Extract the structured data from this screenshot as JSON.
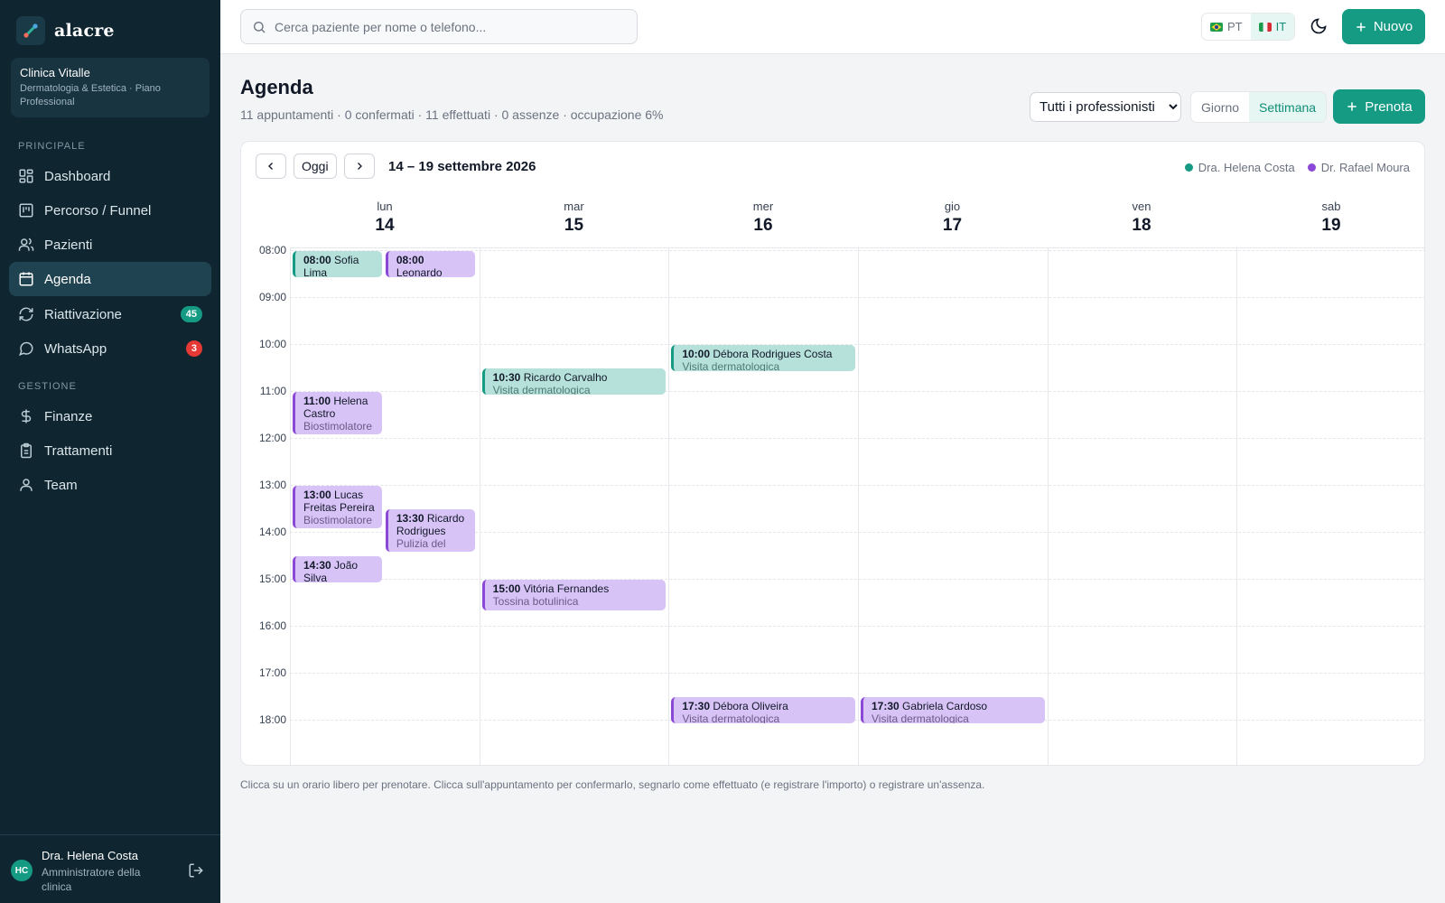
{
  "brand": {
    "name": "alacre"
  },
  "clinic": {
    "name": "Clinica Vitalle",
    "plan": "Dermatologia & Estetica · Piano Professional"
  },
  "sidebar": {
    "section_principale": "PRINCIPALE",
    "section_gestione": "GESTIONE",
    "items": [
      {
        "label": "Dashboard",
        "icon": "dashboard-icon"
      },
      {
        "label": "Percorso / Funnel",
        "icon": "funnel-icon"
      },
      {
        "label": "Pazienti",
        "icon": "users-icon"
      },
      {
        "label": "Agenda",
        "icon": "calendar-icon",
        "active": true
      },
      {
        "label": "Riattivazione",
        "icon": "refresh-icon",
        "badge": "45",
        "badge_color": "#159a83"
      },
      {
        "label": "WhatsApp",
        "icon": "chat-icon",
        "badge": "3",
        "badge_color": "#e53935"
      },
      {
        "label": "Finanze",
        "icon": "dollar-icon"
      },
      {
        "label": "Trattamenti",
        "icon": "clipboard-icon"
      },
      {
        "label": "Team",
        "icon": "user-icon"
      }
    ]
  },
  "user": {
    "initials": "HC",
    "name": "Dra. Helena Costa",
    "role": "Amministratore della clinica"
  },
  "topbar": {
    "search_placeholder": "Cerca paziente per nome o telefono...",
    "lang_pt": "PT",
    "lang_it": "IT",
    "new_label": "Nuovo"
  },
  "page": {
    "title": "Agenda",
    "subtitle": "11 appuntamenti · 0 confermati · 11 effettuati · 0 assenze · occupazione 6%",
    "professional_filter": "Tutti i professionisti",
    "view_day": "Giorno",
    "view_week": "Settimana",
    "book_label": "Prenota"
  },
  "calendar": {
    "today_label": "Oggi",
    "range": "14 – 19 settembre 2026",
    "legend": [
      {
        "name": "Dra. Helena Costa",
        "color": "#159a83"
      },
      {
        "name": "Dr. Rafael Moura",
        "color": "#8b47d6"
      }
    ],
    "days": [
      {
        "name": "lun",
        "num": "14"
      },
      {
        "name": "mar",
        "num": "15"
      },
      {
        "name": "mer",
        "num": "16"
      },
      {
        "name": "gio",
        "num": "17"
      },
      {
        "name": "ven",
        "num": "18"
      },
      {
        "name": "sab",
        "num": "19"
      }
    ],
    "hours": [
      "08:00",
      "09:00",
      "10:00",
      "11:00",
      "12:00",
      "13:00",
      "14:00",
      "15:00",
      "16:00",
      "17:00",
      "18:00"
    ],
    "appointments": [
      {
        "day": 0,
        "lane": "left",
        "start": 8.0,
        "end": 8.6,
        "time": "08:00",
        "patient": "Sofia Lima",
        "service": "",
        "pro": "teal"
      },
      {
        "day": 0,
        "lane": "right",
        "start": 8.0,
        "end": 8.6,
        "time": "08:00",
        "patient": "Leonardo",
        "service": "",
        "pro": "purple"
      },
      {
        "day": 0,
        "lane": "left",
        "start": 11.0,
        "end": 11.95,
        "time": "11:00",
        "patient": "Helena Castro",
        "service": "Biostimolatore di collagene",
        "pro": "purple"
      },
      {
        "day": 0,
        "lane": "left",
        "start": 13.0,
        "end": 13.95,
        "time": "13:00",
        "patient": "Lucas Freitas Pereira",
        "service": "Biostimolatore di collagene",
        "pro": "purple"
      },
      {
        "day": 0,
        "lane": "right",
        "start": 13.5,
        "end": 14.45,
        "time": "13:30",
        "patient": "Ricardo Rodrigues",
        "service": "Pulizia del viso profonda",
        "pro": "purple"
      },
      {
        "day": 0,
        "lane": "left",
        "start": 14.5,
        "end": 15.1,
        "time": "14:30",
        "patient": "João Silva",
        "service": "",
        "pro": "purple"
      },
      {
        "day": 1,
        "lane": "full",
        "start": 10.5,
        "end": 11.1,
        "time": "10:30",
        "patient": "Ricardo Carvalho",
        "service": "Visita dermatologica",
        "pro": "teal"
      },
      {
        "day": 1,
        "lane": "full",
        "start": 15.0,
        "end": 15.7,
        "time": "15:00",
        "patient": "Vitória Fernandes",
        "service": "Tossina botulinica",
        "pro": "purple"
      },
      {
        "day": 2,
        "lane": "full",
        "start": 10.0,
        "end": 10.6,
        "time": "10:00",
        "patient": "Débora Rodrigues Costa",
        "service": "Visita dermatologica",
        "pro": "teal"
      },
      {
        "day": 2,
        "lane": "full",
        "start": 17.5,
        "end": 18.1,
        "time": "17:30",
        "patient": "Débora Oliveira",
        "service": "Visita dermatologica",
        "pro": "purple"
      },
      {
        "day": 3,
        "lane": "full",
        "start": 17.5,
        "end": 18.1,
        "time": "17:30",
        "patient": "Gabriela Cardoso",
        "service": "Visita dermatologica",
        "pro": "purple"
      }
    ]
  },
  "footer_hint": "Clicca su un orario libero per prenotare. Clicca sull'appuntamento per confermarlo, segnarlo come effettuato (e registrare l'importo) o registrare un'assenza."
}
